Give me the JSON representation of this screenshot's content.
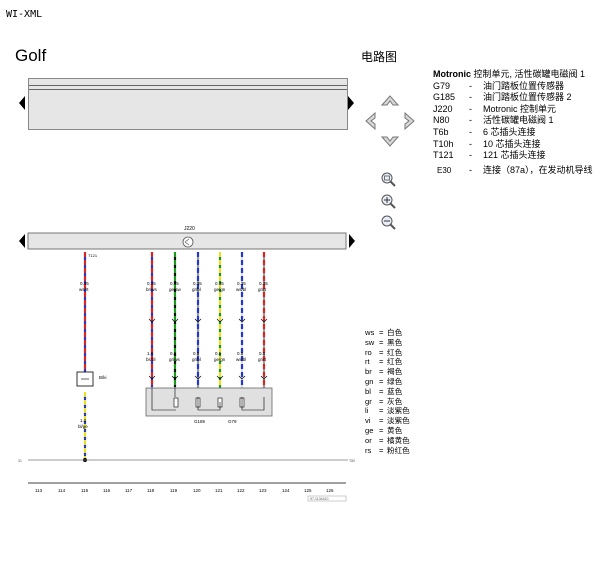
{
  "window": {
    "title": "WI-XML"
  },
  "vehicle": {
    "model": "Golf"
  },
  "diagram": {
    "section_title": "电路图",
    "ecu_label": "J220",
    "component_label_b": "B/ki",
    "ground_left": "31",
    "ground_right": "T80",
    "sensor_labels": [
      "G185",
      "G79"
    ],
    "wires": [
      {
        "pin": "T121\n88",
        "size": "0.35",
        "color": "ws/rt"
      },
      {
        "pin": "T121\n58",
        "size": "0.35",
        "color": "br/ws"
      },
      {
        "pin": "T121\n57",
        "size": "0.35",
        "color": "ge/sw"
      },
      {
        "pin": "T121\n35",
        "size": "0.35",
        "color": "gr/bl"
      },
      {
        "pin": "T121\n70",
        "size": "0.35",
        "color": "ge/gn"
      },
      {
        "pin": "T121\n72",
        "size": "0.35",
        "color": "ws/bl"
      },
      {
        "pin": "T121\n50",
        "size": "0.35",
        "color": "gr/rt"
      }
    ],
    "lower_wires": [
      {
        "size": "1.0",
        "color": "bl/ge"
      },
      {
        "size": "1.0",
        "color": "bs/bl"
      },
      {
        "size": "0.5",
        "color": "gr/ws"
      },
      {
        "size": "0.5",
        "color": "gr/bl"
      },
      {
        "size": "0.5",
        "color": "ge/gn"
      },
      {
        "size": "0.5",
        "color": "ws/bl"
      },
      {
        "size": "0.5",
        "color": "gr/rt"
      }
    ],
    "scale": [
      "113",
      "114",
      "115",
      "116",
      "117",
      "118",
      "119",
      "120",
      "121",
      "122",
      "123",
      "124",
      "125",
      "126"
    ],
    "footer_code": "97-1134410"
  },
  "legend": {
    "title_bold": "Motronic",
    "title_rest": " 控制单元, 活性碳罐电磁阀 1",
    "items": [
      {
        "code": "G79",
        "desc": "油门踏板位置传感器"
      },
      {
        "code": "G185",
        "desc": "油门踏板位置传感器 2"
      },
      {
        "code": "J220",
        "desc": "Motronic 控制单元"
      },
      {
        "code": "N80",
        "desc": "活性碳罐电磁阀 1"
      },
      {
        "code": "T6b",
        "desc": "6 芯插头连接"
      },
      {
        "code": "T10h",
        "desc": "10 芯插头连接"
      },
      {
        "code": "T121",
        "desc": "121 芯插头连接"
      },
      {
        "code": "E30",
        "desc": "连接（87a），在发动机导线"
      }
    ]
  },
  "colors": [
    {
      "code": "ws",
      "name": "白色"
    },
    {
      "code": "sw",
      "name": "黑色"
    },
    {
      "code": "ro",
      "name": "红色"
    },
    {
      "code": "rt",
      "name": "红色"
    },
    {
      "code": "br",
      "name": "褐色"
    },
    {
      "code": "gn",
      "name": "绿色"
    },
    {
      "code": "bl",
      "name": "蓝色"
    },
    {
      "code": "gr",
      "name": "灰色"
    },
    {
      "code": "li",
      "name": "淡紫色"
    },
    {
      "code": "vi",
      "name": "淡紫色"
    },
    {
      "code": "ge",
      "name": "黄色"
    },
    {
      "code": "or",
      "name": "橘黄色"
    },
    {
      "code": "rs",
      "name": "粉红色"
    }
  ],
  "icons": [
    "nav-up-icon",
    "nav-left-icon",
    "nav-right-icon",
    "nav-down-icon",
    "zoom-fit-icon",
    "zoom-in-icon",
    "zoom-out-icon",
    "scroll-left-icon",
    "scroll-right-icon"
  ]
}
